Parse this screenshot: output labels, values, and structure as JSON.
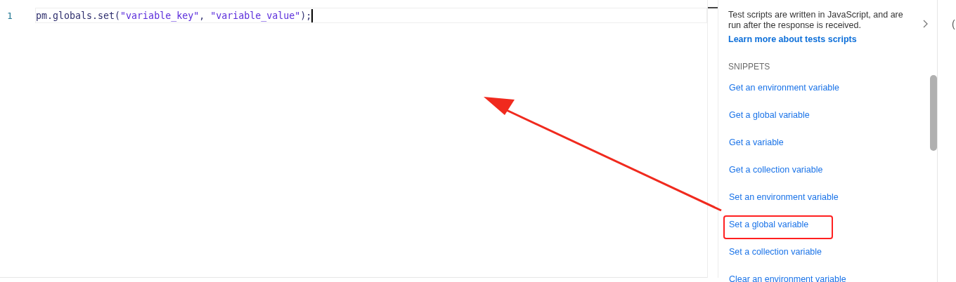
{
  "editor": {
    "lines": [
      {
        "number": "1",
        "tokens": [
          {
            "kind": "plain",
            "text": "pm.globals.set("
          },
          {
            "kind": "string",
            "text": "\"variable_key\""
          },
          {
            "kind": "plain",
            "text": ", "
          },
          {
            "kind": "string",
            "text": "\"variable_value\""
          },
          {
            "kind": "plain",
            "text": ");"
          }
        ]
      }
    ]
  },
  "side_panel": {
    "description": "Test scripts are written in JavaScript, and are run after the response is received.",
    "link": "Learn more about tests scripts",
    "section_title": "SNIPPETS",
    "snippets": [
      {
        "label": "Get an environment variable",
        "highlighted": false
      },
      {
        "label": "Get a global variable",
        "highlighted": false
      },
      {
        "label": "Get a variable",
        "highlighted": false
      },
      {
        "label": "Get a collection variable",
        "highlighted": false
      },
      {
        "label": "Set an environment variable",
        "highlighted": false
      },
      {
        "label": "Set a global variable",
        "highlighted": true
      },
      {
        "label": "Set a collection variable",
        "highlighted": false
      },
      {
        "label": "Clear an environment variable",
        "highlighted": false
      }
    ]
  },
  "right_edge_text": "("
}
